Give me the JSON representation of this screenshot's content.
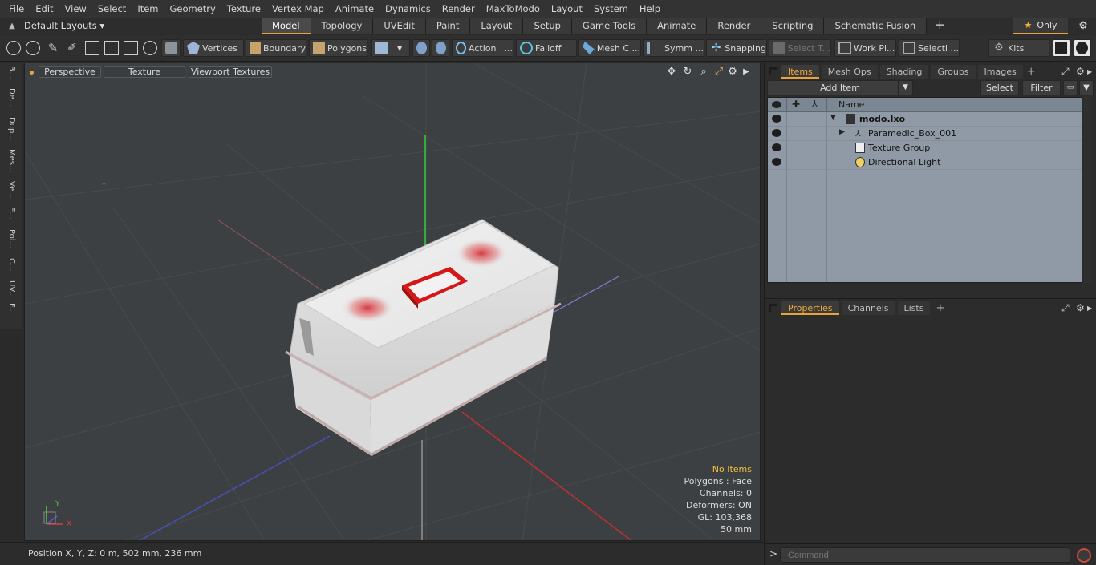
{
  "menu": [
    "File",
    "Edit",
    "View",
    "Select",
    "Item",
    "Geometry",
    "Texture",
    "Vertex Map",
    "Animate",
    "Dynamics",
    "Render",
    "MaxToModo",
    "Layout",
    "System",
    "Help"
  ],
  "layoutbar": {
    "default_layouts": "Default Layouts ▾",
    "tabs": [
      "Model",
      "Topology",
      "UVEdit",
      "Paint",
      "Layout",
      "Setup",
      "Game Tools",
      "Animate",
      "Render",
      "Scripting",
      "Schematic Fusion"
    ],
    "active_tab": "Model",
    "only_label": "Only",
    "accent": "#e8a43a"
  },
  "toolbar": {
    "vertices": "Vertices",
    "boundary": "Boundary",
    "polygons": "Polygons",
    "action": "Action",
    "action_more": "...",
    "falloff": "Falloff",
    "mesh": "Mesh C ...",
    "symm": "Symm ...",
    "snapping": "Snapping",
    "select_t": "Select T...",
    "work_pl": "Work Pl...",
    "selecti": "Selecti ...",
    "kits": "Kits"
  },
  "lefttabs": [
    "B...",
    "De...",
    "Dup...",
    "Mes...",
    "Ve...",
    "E...",
    "Pol...",
    "C...",
    "UV...",
    "F..."
  ],
  "viewport": {
    "tabs": [
      "Perspective",
      "Texture",
      "Viewport Textures"
    ],
    "info": {
      "selection": "No Items",
      "polygons": "Polygons : Face",
      "channels": "Channels: 0",
      "deformers": "Deformers: ON",
      "gl": "GL: 103,368",
      "scale": "50 mm"
    },
    "axis_x": "X",
    "axis_y": "Y"
  },
  "status": {
    "position": "Position X, Y, Z:   0 m, 502 mm, 236 mm"
  },
  "items_panel": {
    "tabs": [
      "Items",
      "Mesh Ops",
      "Shading",
      "Groups",
      "Images"
    ],
    "active_tab": "Items",
    "add_item": "Add Item",
    "select": "Select",
    "filter": "Filter",
    "name_header": "Name",
    "rows": [
      {
        "label": "modo.lxo",
        "bold": true
      },
      {
        "label": "Paramedic_Box_001",
        "bold": false
      },
      {
        "label": "Texture Group",
        "bold": false
      },
      {
        "label": "Directional Light",
        "bold": false
      }
    ]
  },
  "props_panel": {
    "tabs": [
      "Properties",
      "Channels",
      "Lists"
    ],
    "active_tab": "Properties"
  },
  "command": {
    "prompt": ">",
    "placeholder": "Command"
  }
}
